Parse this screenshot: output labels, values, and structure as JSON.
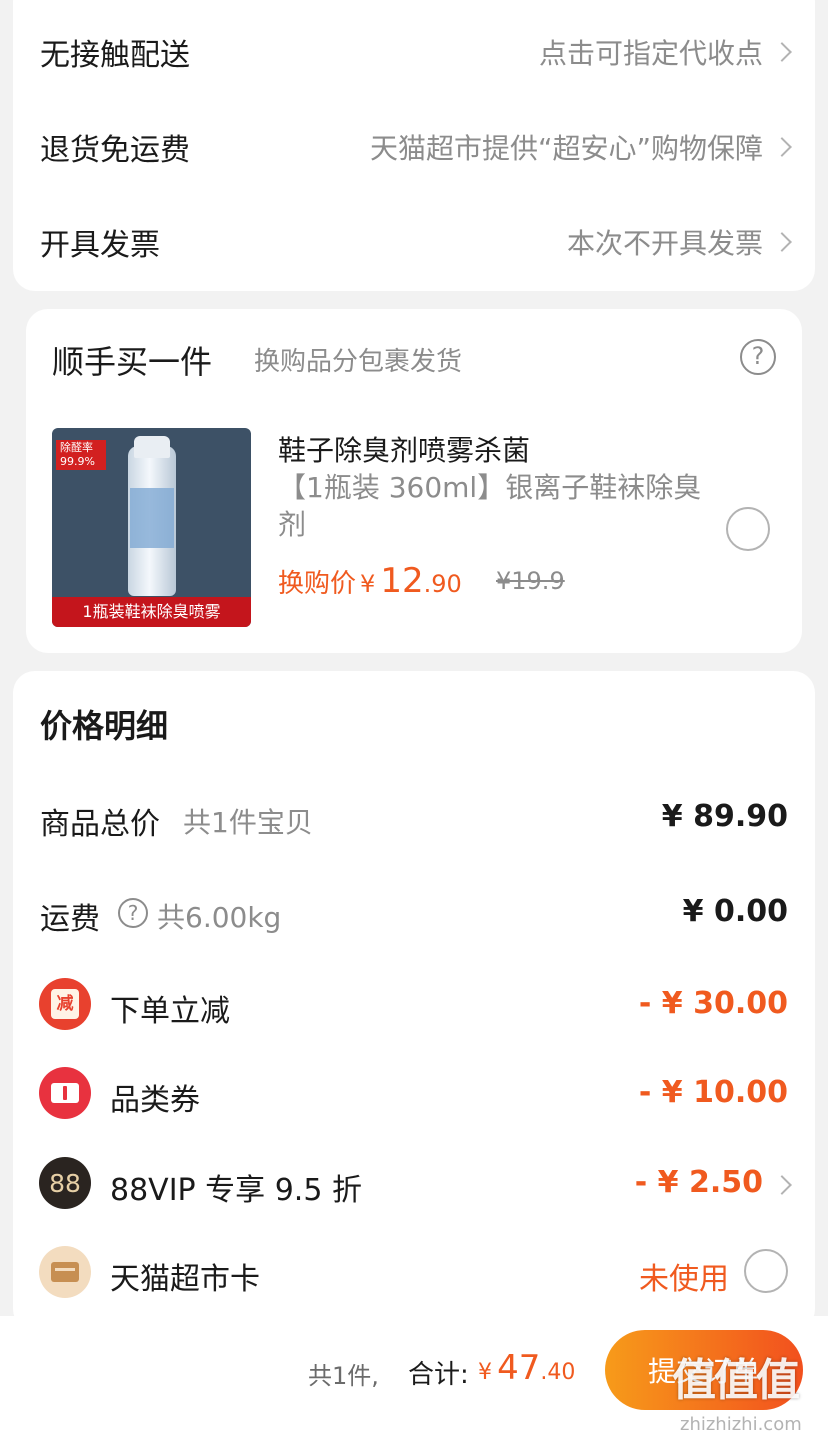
{
  "delivery": {
    "rows": [
      {
        "label": "无接触配送",
        "value": "点击可指定代收点"
      },
      {
        "label": "退货免运费",
        "value": "天猫超市提供“超安心”购物保障"
      },
      {
        "label": "开具发票",
        "value": "本次不开具发票"
      }
    ]
  },
  "addon": {
    "title": "顺手买一件",
    "subtitle": "换购品分包裹发货",
    "help_icon": "?",
    "product": {
      "image_badge": "除醛率 99.9%",
      "image_caption": "1瓶装鞋袜除臭喷雾",
      "title": "鞋子除臭剂喷雾杀菌",
      "desc": "【1瓶装 360ml】银离子鞋袜除臭剂",
      "price_label": "换购价",
      "price_symbol": "¥",
      "price_int": "12",
      "price_dec": ".90",
      "original_price": "¥19.9"
    }
  },
  "price": {
    "title": "价格明细",
    "subtotal": {
      "label": "商品总价",
      "sub": "共1件宝贝",
      "value": "¥ 89.90"
    },
    "shipping": {
      "label": "运费",
      "help": "?",
      "sub": "共6.00kg",
      "value": "¥ 0.00"
    },
    "discounts": [
      {
        "icon": "instant-discount-icon",
        "icon_text": "减",
        "label": "下单立减",
        "value": "- ¥ 30.00"
      },
      {
        "icon": "coupon-icon",
        "label": "品类券",
        "value": "- ¥ 10.00"
      },
      {
        "icon": "vip88-icon",
        "icon_text": "88",
        "label": "88VIP 专享 9.5 折",
        "value": "- ¥ 2.50"
      }
    ],
    "card": {
      "icon": "supermarket-card-icon",
      "label": "天猫超市卡",
      "value": "未使用"
    }
  },
  "bottom": {
    "count": "共1件,",
    "total_label": "合计:",
    "symbol": "¥",
    "total_int": "47",
    "total_dec": ".40",
    "submit": "提交订单"
  },
  "watermark": {
    "text": "值值值",
    "sub": "zhizhizhi.com"
  },
  "colors": {
    "accent": "#f05a1f",
    "background": "#f2f2f2",
    "muted": "#8c8c8c"
  }
}
